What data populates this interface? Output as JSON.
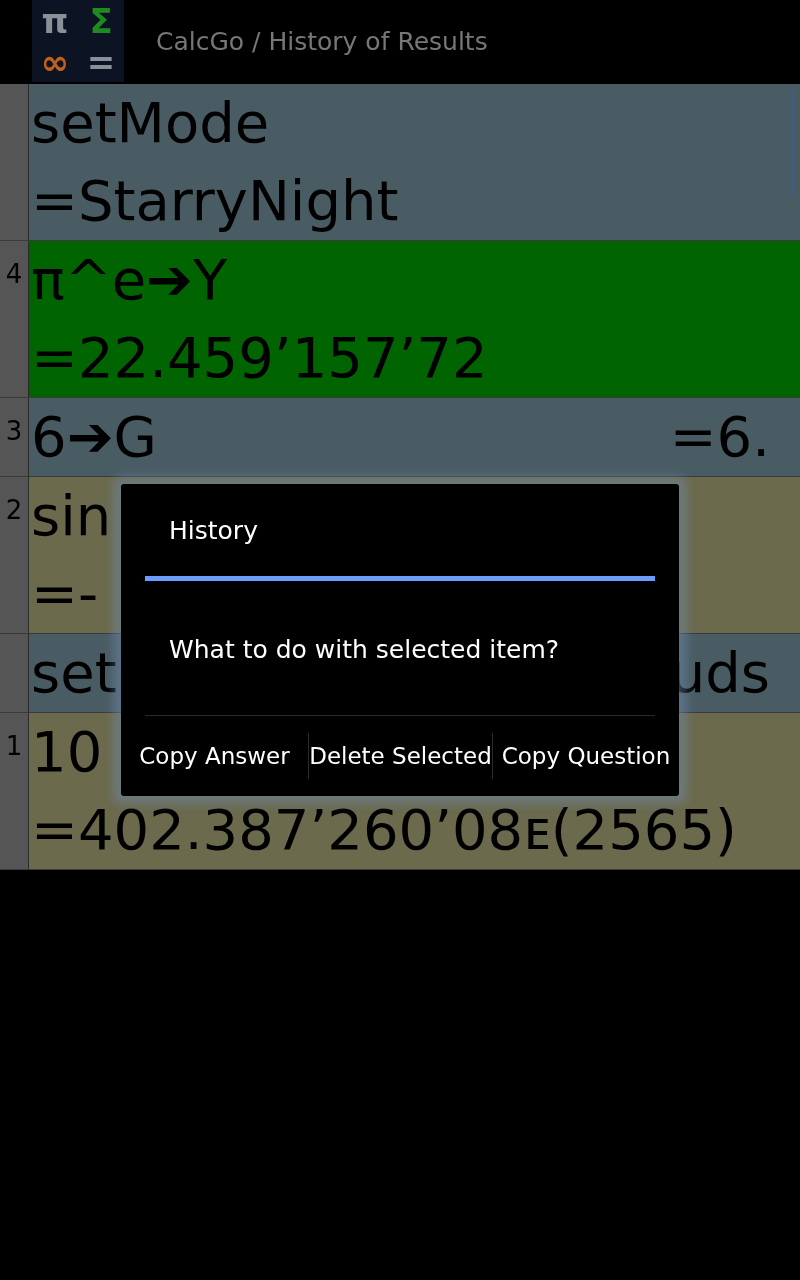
{
  "app_bar": {
    "logo": [
      "π",
      "Σ",
      "∞",
      "="
    ],
    "title": "CalcGo / History of Results"
  },
  "rows": [
    {
      "kind": "stacked",
      "selected": false,
      "color": "#4a5c63",
      "question": "setMode",
      "answer": "=StarryNight"
    },
    {
      "kind": "stacked",
      "number": "4",
      "selected": true,
      "question": "π^e➔Y",
      "answer": "=22.459’157’72"
    },
    {
      "kind": "inline",
      "number": "3",
      "selected": false,
      "color": "#4a5c63",
      "question": "6➔G",
      "answer": "=6."
    },
    {
      "kind": "stacked",
      "number": "2",
      "selected": false,
      "color": "#6b6a4d",
      "question": "sin",
      "answer": "=-"
    },
    {
      "kind": "inline",
      "selected": false,
      "color": "#4a5c63",
      "question": "set",
      "answer": "uds"
    },
    {
      "kind": "stacked",
      "number": "1",
      "selected": false,
      "color": "#6b6a4d",
      "question": "10",
      "answer": "=402.387’260’08ᴇ(2565)"
    }
  ],
  "dialog": {
    "title": "History",
    "message": "What to do with selected item?",
    "buttons": [
      "Copy Answer",
      "Delete Selected",
      "Copy Question"
    ]
  }
}
